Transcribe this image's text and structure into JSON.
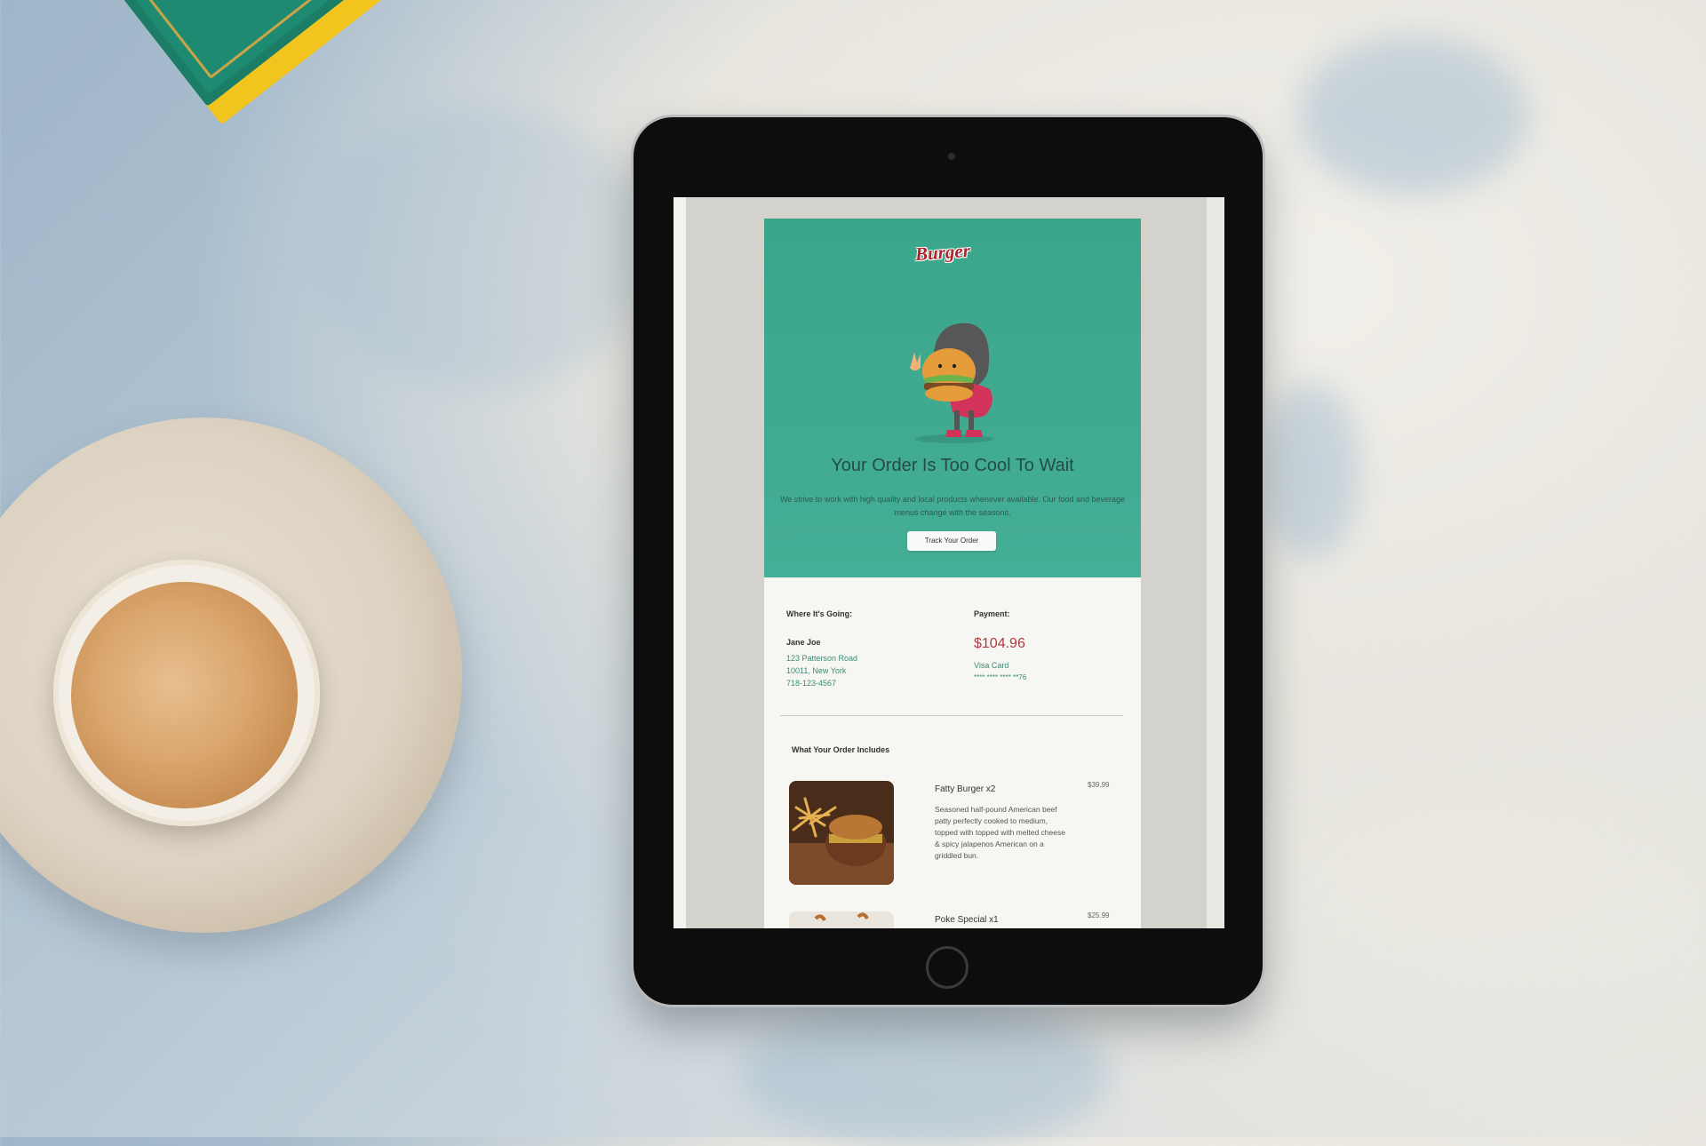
{
  "email": {
    "brand": "Burger",
    "hero": {
      "title": "Your Order Is Too Cool To Wait",
      "description": "We strive to work with high quality and local products whenever available. Our food and beverage menus change with the seasons.",
      "track_button": "Track Your Order"
    },
    "shipping": {
      "heading": "Where It's Going:",
      "name": "Jane Joe",
      "address_line1": "123 Patterson Road",
      "address_line2": "10011, New York",
      "phone": "718-123-4567"
    },
    "payment": {
      "heading": "Payment:",
      "amount": "$104.96",
      "method": "Visa Card",
      "card_number": "**** **** **** **76"
    },
    "order": {
      "heading": "What Your Order Includes",
      "items": [
        {
          "name": "Fatty Burger x2",
          "price": "$39.99",
          "description": "Seasoned half-pound American beef patty perfectly cooked to medium, topped with topped with melted cheese & spicy jalapenos American on a griddled bun."
        },
        {
          "name": "Poke Special x1",
          "price": "$25.99",
          "description": ""
        }
      ]
    }
  },
  "colors": {
    "hero_green": "#3aa68a",
    "accent_red": "#b23a44",
    "link_green": "#3b8c74"
  }
}
